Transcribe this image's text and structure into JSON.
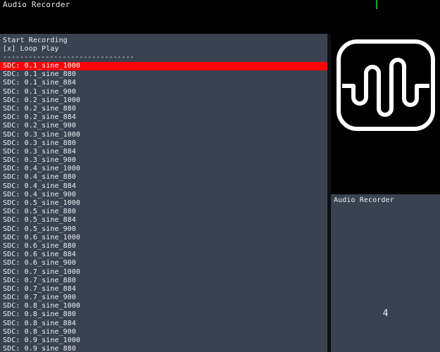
{
  "header": {
    "title": "Audio Recorder",
    "caret_color": "#19a319"
  },
  "colors": {
    "panel_bg": "#3a4150",
    "window_bg": "#000000",
    "selection": "#fa0505",
    "text": "#eceff4"
  },
  "left_panel": {
    "menu": [
      {
        "label": "Start Recording"
      },
      {
        "label": "[x] Loop Play"
      }
    ],
    "divider": "-------------------------------",
    "selected_index": 0,
    "files": [
      "SDC: 0.1_sine_1000",
      "SDC: 0.1_sine_880",
      "SDC: 0.1_sine_884",
      "SDC: 0.1_sine_900",
      "SDC: 0.2_sine_1000",
      "SDC: 0.2_sine_880",
      "SDC: 0.2_sine_884",
      "SDC: 0.2_sine_900",
      "SDC: 0.3_sine_1000",
      "SDC: 0.3_sine_880",
      "SDC: 0.3_sine_884",
      "SDC: 0.3_sine_900",
      "SDC: 0.4_sine_1000",
      "SDC: 0.4_sine_880",
      "SDC: 0.4_sine_884",
      "SDC: 0.4_sine_900",
      "SDC: 0.5_sine_1000",
      "SDC: 0.5_sine_880",
      "SDC: 0.5_sine_884",
      "SDC: 0.5_sine_900",
      "SDC: 0.6_sine_1000",
      "SDC: 0.6_sine_880",
      "SDC: 0.6_sine_884",
      "SDC: 0.6_sine_900",
      "SDC: 0.7_sine_1000",
      "SDC: 0.7_sine_880",
      "SDC: 0.7_sine_884",
      "SDC: 0.7_sine_900",
      "SDC: 0.8_sine_1000",
      "SDC: 0.8_sine_880",
      "SDC: 0.8_sine_884",
      "SDC: 0.8_sine_900",
      "SDC: 0.9_sine_1000",
      "SDC: 0.9_sine_880"
    ]
  },
  "right_panel": {
    "icon_name": "audio-waveform-icon",
    "bottom_title": "Audio Recorder",
    "bottom_value": "4"
  }
}
